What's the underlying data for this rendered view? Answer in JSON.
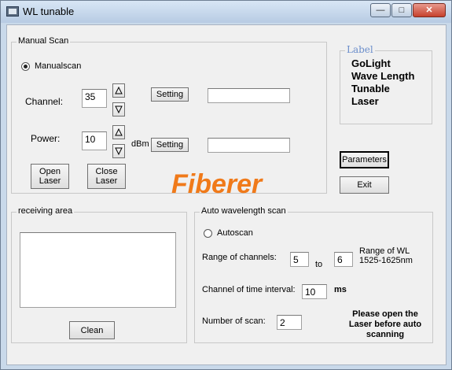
{
  "window": {
    "title": "WL tunable",
    "minimize_icon": "minimize-icon",
    "maximize_icon": "maximize-icon",
    "close_icon": "close-icon"
  },
  "manual_scan": {
    "group_label": "Manual Scan",
    "mode_label": "Manualscan",
    "mode_selected": true,
    "channel_label": "Channel:",
    "channel_value": "35",
    "channel_setting_label": "Setting",
    "channel_output": "",
    "power_label": "Power:",
    "power_value": "10",
    "power_unit": "dBm",
    "power_setting_label": "Setting",
    "power_output": "",
    "open_laser_label": "Open\nLaser",
    "close_laser_label": "Close\nLaser"
  },
  "label_box": {
    "title": "Label",
    "lines": [
      "GoLight",
      "Wave Length",
      "Tunable",
      "Laser"
    ]
  },
  "buttons": {
    "parameters_label": "Parameters",
    "exit_label": "Exit"
  },
  "watermark": "Fiberer",
  "receiving_area": {
    "group_label": "receiving area",
    "content": "",
    "clean_label": "Clean"
  },
  "auto_scan": {
    "group_label": "Auto wavelength scan",
    "mode_label": "Autoscan",
    "mode_selected": false,
    "range_label": "Range of channels:",
    "range_from": "5",
    "range_to_label": "to",
    "range_to": "6",
    "range_info_line1": "Range of WL",
    "range_info_line2": "1525-1625nm",
    "interval_label": "Channel of time interval:",
    "interval_value": "10",
    "interval_unit": "ms",
    "scan_count_label": "Number of scan:",
    "scan_count_value": "2",
    "warning_line1": "Please open the",
    "warning_line2": "Laser before auto",
    "warning_line3": "scanning"
  },
  "colors": {
    "title_bar": "#c9d9ea",
    "client_bg": "#f0f0f0",
    "label_title": "#6b8ecb",
    "watermark": "#f07a1a",
    "close_button": "#c6402c"
  },
  "icons": {
    "spin_up": "triangle-up-icon",
    "spin_down": "triangle-down-icon"
  }
}
